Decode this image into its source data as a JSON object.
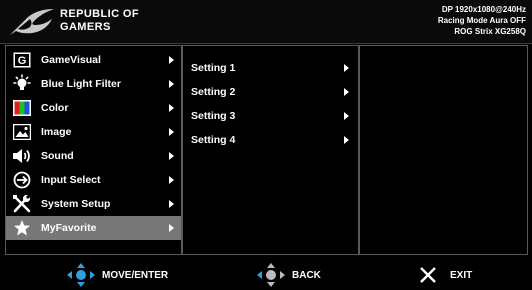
{
  "header": {
    "brand_line1": "REPUBLIC OF",
    "brand_line2": "GAMERS",
    "status_line1": "DP 1920x1080@240Hz",
    "status_line2": "Racing Mode  Aura OFF",
    "status_line3": "ROG Strix XG258Q"
  },
  "menu": {
    "items": [
      {
        "label": "GameVisual",
        "icon": "gamevisual-icon"
      },
      {
        "label": "Blue Light Filter",
        "icon": "bulb-icon"
      },
      {
        "label": "Color",
        "icon": "color-icon"
      },
      {
        "label": "Image",
        "icon": "image-icon"
      },
      {
        "label": "Sound",
        "icon": "speaker-icon"
      },
      {
        "label": "Input Select",
        "icon": "input-select-icon"
      },
      {
        "label": "System Setup",
        "icon": "wrench-screwdriver-icon"
      },
      {
        "label": "MyFavorite",
        "icon": "star-icon"
      }
    ],
    "selected_index": 7,
    "selected_color": "#777777"
  },
  "submenu": {
    "items": [
      {
        "label": "Setting 1"
      },
      {
        "label": "Setting 2"
      },
      {
        "label": "Setting 3"
      },
      {
        "label": "Setting 4"
      }
    ]
  },
  "footer": {
    "move_label": "MOVE/ENTER",
    "back_label": "BACK",
    "exit_label": "EXIT",
    "accent_color": "#2f9fe0"
  }
}
